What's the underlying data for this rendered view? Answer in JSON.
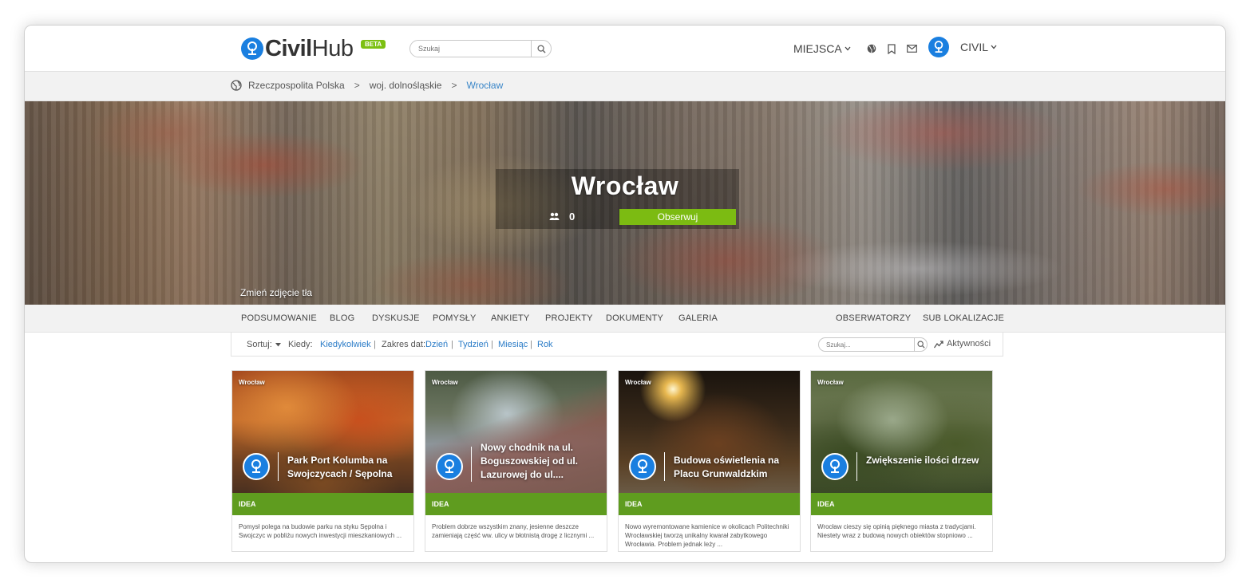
{
  "header": {
    "logo_civil": "Civil",
    "logo_hub": "Hub",
    "beta": "BETA",
    "search_placeholder": "Szukaj",
    "nav_miejsca": "MIEJSCA",
    "user_name": "CIVIL"
  },
  "breadcrumb": {
    "items": [
      "Rzeczpospolita Polska",
      "woj. dolnośląskie",
      "Wrocław"
    ],
    "separator": ">"
  },
  "hero": {
    "title": "Wrocław",
    "followers": "0",
    "follow_button": "Obserwuj",
    "change_background": "Zmień zdjęcie tła"
  },
  "tabs": {
    "left": [
      "PODSUMOWANIE",
      "BLOG",
      "DYSKUSJE",
      "POMYSŁY",
      "ANKIETY",
      "PROJEKTY",
      "DOKUMENTY",
      "GALERIA"
    ],
    "right": [
      "OBSERWATORZY",
      "SUB LOKALIZACJE"
    ]
  },
  "filter": {
    "sort_label": "Sortuj:",
    "when_label": "Kiedy:",
    "when_value": "Kiedykolwiek",
    "range_label": "Zakres dat:",
    "ranges": [
      "Dzień",
      "Tydzień",
      "Miesiąc",
      "Rok"
    ],
    "search_placeholder": "Szukaj...",
    "activity": "Aktywności"
  },
  "cards": [
    {
      "location": "Wrocław",
      "title": "Park Port Kolumba na Swojczycach / Sępolna",
      "tag": "IDEA",
      "desc": "Pomysł polega na budowie parku na styku Sępolna i Swojczyc w pobliżu nowych inwestycji mieszkaniowych ..."
    },
    {
      "location": "Wrocław",
      "title": "Nowy chodnik na ul. Boguszowskiej od ul. Lazurowej do ul....",
      "tag": "IDEA",
      "desc": "Problem dobrze wszystkim znany, jesienne deszcze zamieniają część ww. ulicy w błotnistą drogę z licznymi ..."
    },
    {
      "location": "Wrocław",
      "title": "Budowa oświetlenia na Placu Grunwaldzkim",
      "tag": "IDEA",
      "desc": "Nowo wyremontowane kamienice w okolicach Politechniki Wrocławskiej tworzą unikalny kwarał zabytkowego Wrocławia. Problem jednak leży ..."
    },
    {
      "location": "Wrocław",
      "title": "Zwiększenie ilości drzew",
      "tag": "IDEA",
      "desc": "Wrocław cieszy się opinią pięknego miasta z tradycjami. Niestety wraz z budową nowych obiektów stopniowo ..."
    }
  ],
  "colors": {
    "brand_blue": "#1a7fe0",
    "follow_green": "#7cbb12",
    "idea_green": "#5f9c1f",
    "link_blue": "#2b7cc7"
  },
  "icons": [
    "civilhub-logo-icon",
    "search-icon",
    "chevron-down-icon",
    "globe-icon",
    "bookmark-icon",
    "mail-icon",
    "user-avatar-icon",
    "followers-icon",
    "activity-chart-icon",
    "sort-caret-icon"
  ]
}
